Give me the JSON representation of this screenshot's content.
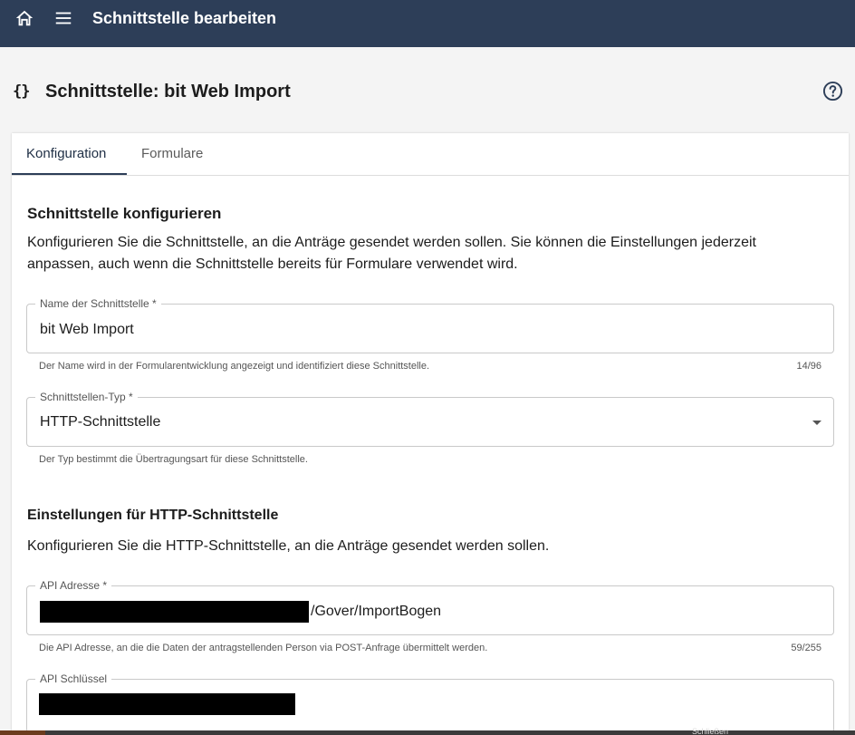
{
  "header": {
    "title": "Schnittstelle bearbeiten",
    "icons": [
      "home-icon",
      "menu-icon"
    ]
  },
  "page": {
    "title": "Schnittstelle: bit Web Import",
    "braces_icon": "{}",
    "help_icon": "help-circle-icon"
  },
  "tabs": [
    {
      "label": "Konfiguration",
      "active": true
    },
    {
      "label": "Formulare",
      "active": false
    }
  ],
  "section1": {
    "title": "Schnittstelle konfigurieren",
    "description": "Konfigurieren Sie die Schnittstelle, an die Anträge gesendet werden sollen. Sie können die Einstellungen jederzeit anpassen, auch wenn die Schnittstelle bereits für Formulare verwendet wird."
  },
  "fields": {
    "name": {
      "label": "Name der Schnittstelle *",
      "value": "bit Web Import",
      "hint": "Der Name wird in der Formularentwicklung angezeigt und identifiziert diese Schnittstelle.",
      "counter": "14/96"
    },
    "type": {
      "label": "Schnittstellen-Typ *",
      "value": "HTTP-Schnittstelle",
      "hint": "Der Typ bestimmt die Übertragungsart für diese Schnittstelle."
    },
    "api_address": {
      "label": "API Adresse *",
      "value_visible": "/Gover/ImportBogen",
      "hint": "Die API Adresse, an die die Daten der antragstellenden Person via POST-Anfrage übermittelt werden.",
      "counter": "59/255"
    },
    "api_key": {
      "label": "API Schlüssel"
    }
  },
  "section2": {
    "title": "Einstellungen für HTTP-Schnittstelle",
    "description": "Konfigurieren Sie die HTTP-Schnittstelle, an die Anträge gesendet werden sollen."
  },
  "bottom": {
    "partial_text": "Schließen"
  },
  "colors": {
    "header_bg": "#2d3e58",
    "page_bg": "#f4f4f4",
    "card_bg": "#ffffff",
    "active_tab": "#2d3e58"
  }
}
